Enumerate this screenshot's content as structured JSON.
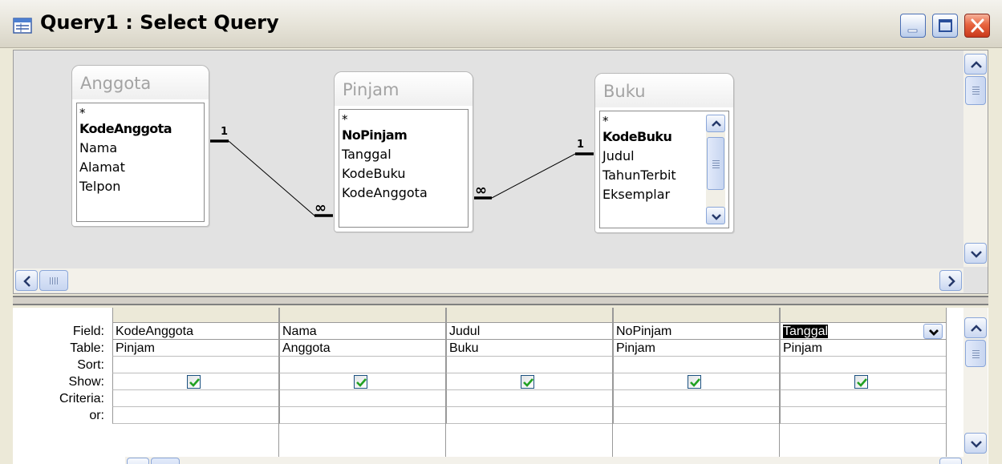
{
  "window": {
    "title": "Query1 : Select Query"
  },
  "icons": {
    "window": "query-window-icon",
    "minimize": "minimize-icon",
    "maximize": "maximize-icon",
    "close": "close-icon"
  },
  "tables": [
    {
      "name": "Anggota",
      "fields": [
        "*",
        "KodeAnggota",
        "Nama",
        "Alamat",
        "Telpon"
      ],
      "key_field": "KodeAnggota"
    },
    {
      "name": "Pinjam",
      "fields": [
        "*",
        "NoPinjam",
        "Tanggal",
        "KodeBuku",
        "KodeAnggota"
      ],
      "key_field": "NoPinjam"
    },
    {
      "name": "Buku",
      "fields": [
        "*",
        "KodeBuku",
        "Judul",
        "TahunTerbit",
        "Eksemplar"
      ],
      "key_field": "KodeBuku"
    }
  ],
  "relationships": [
    {
      "from": "Anggota.KodeAnggota",
      "to": "Pinjam.KodeAnggota",
      "one_label": "1",
      "many_label": "∞"
    },
    {
      "from": "Pinjam.KodeBuku",
      "to": "Buku.KodeBuku",
      "one_label": "1",
      "many_label": "∞"
    }
  ],
  "grid": {
    "row_labels": [
      "Field:",
      "Table:",
      "Sort:",
      "Show:",
      "Criteria:",
      "or:"
    ],
    "columns": [
      {
        "field": "KodeAnggota",
        "table": "Pinjam",
        "sort": "",
        "show": true,
        "criteria": "",
        "or": ""
      },
      {
        "field": "Nama",
        "table": "Anggota",
        "sort": "",
        "show": true,
        "criteria": "",
        "or": ""
      },
      {
        "field": "Judul",
        "table": "Buku",
        "sort": "",
        "show": true,
        "criteria": "",
        "or": ""
      },
      {
        "field": "NoPinjam",
        "table": "Pinjam",
        "sort": "",
        "show": true,
        "criteria": "",
        "or": ""
      },
      {
        "field": "Tanggal",
        "table": "Pinjam",
        "sort": "",
        "show": true,
        "criteria": "",
        "or": "",
        "selected": true
      }
    ]
  },
  "colors": {
    "check": "#21a121",
    "pane_background": "#e2e2e2",
    "table_title": "#a3a3a3"
  }
}
